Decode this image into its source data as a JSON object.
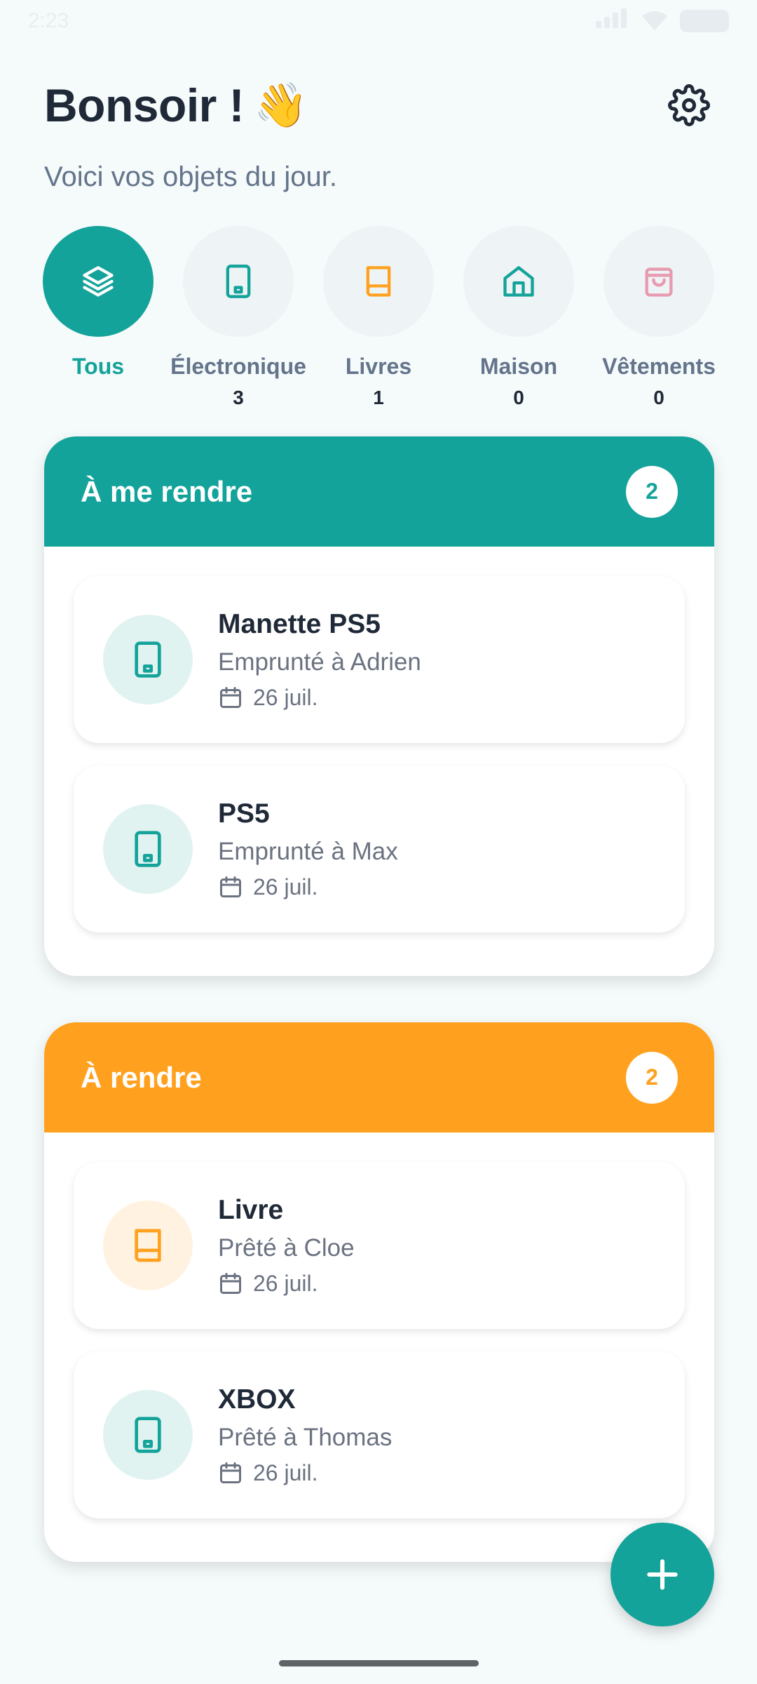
{
  "status_bar": {
    "time": "2:23"
  },
  "header": {
    "greeting": "Bonsoir !",
    "emoji": "👋",
    "settings_icon": "gear-icon"
  },
  "subtitle": "Voici vos objets du jour.",
  "colors": {
    "teal": "#14A39A",
    "orange": "#FFA11F",
    "pink": "#E89AB0",
    "bg": "#F5FAFB"
  },
  "categories": [
    {
      "label": "Tous",
      "count": "",
      "icon": "layers-icon",
      "active": true
    },
    {
      "label": "Électronique",
      "count": "3",
      "icon": "tablet-icon"
    },
    {
      "label": "Livres",
      "count": "1",
      "icon": "book-icon"
    },
    {
      "label": "Maison",
      "count": "0",
      "icon": "house-icon"
    },
    {
      "label": "Vêtements",
      "count": "0",
      "icon": "bag-icon"
    }
  ],
  "sections": [
    {
      "title": "À me rendre",
      "count": "2",
      "items": [
        {
          "name": "Manette PS5",
          "who": "Emprunté à Adrien",
          "date": "26 juil.",
          "icon": "tablet-icon"
        },
        {
          "name": "PS5",
          "who": "Emprunté à Max",
          "date": "26 juil.",
          "icon": "tablet-icon"
        }
      ]
    },
    {
      "title": "À rendre",
      "count": "2",
      "items": [
        {
          "name": "Livre",
          "who": "Prêté à Cloe",
          "date": "26 juil.",
          "icon": "book-icon"
        },
        {
          "name": "XBOX",
          "who": "Prêté à Thomas",
          "date": "26 juil.",
          "icon": "tablet-icon"
        }
      ]
    }
  ],
  "fab": {
    "icon": "plus-icon"
  }
}
